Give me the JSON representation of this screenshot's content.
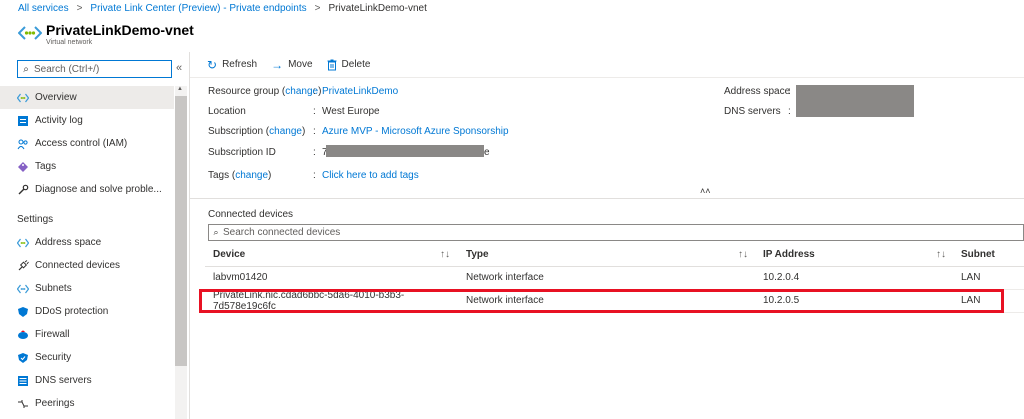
{
  "breadcrumb": {
    "items": [
      "All services",
      "Private Link Center (Preview) - Private endpoints"
    ],
    "current": "PrivateLinkDemo-vnet",
    "separator": ">"
  },
  "resource": {
    "title": "PrivateLinkDemo-vnet",
    "subtitle": "Virtual network",
    "icon": "vnet-icon"
  },
  "sidebar": {
    "search_placeholder": "Search (Ctrl+/)",
    "collapse_glyph": "«",
    "items": [
      {
        "label": "Overview",
        "icon": "vnet-icon",
        "active": true
      },
      {
        "label": "Activity log",
        "icon": "activity-log-icon"
      },
      {
        "label": "Access control (IAM)",
        "icon": "people-icon"
      },
      {
        "label": "Tags",
        "icon": "tag-icon"
      },
      {
        "label": "Diagnose and solve proble...",
        "icon": "wrench-icon"
      }
    ],
    "section_title": "Settings",
    "settings_items": [
      {
        "label": "Address space",
        "icon": "vnet-icon"
      },
      {
        "label": "Connected devices",
        "icon": "plug-icon"
      },
      {
        "label": "Subnets",
        "icon": "vnet-icon"
      },
      {
        "label": "DDoS protection",
        "icon": "shield-icon"
      },
      {
        "label": "Firewall",
        "icon": "firewall-icon"
      },
      {
        "label": "Security",
        "icon": "security-shield-icon"
      },
      {
        "label": "DNS servers",
        "icon": "dns-icon"
      },
      {
        "label": "Peerings",
        "icon": "peering-icon"
      }
    ]
  },
  "toolbar": {
    "refresh_label": "Refresh",
    "move_label": "Move",
    "delete_label": "Delete"
  },
  "essentials": {
    "resource_group_label": "Resource group",
    "change_label": "change",
    "resource_group_value": "PrivateLinkDemo",
    "location_label": "Location",
    "location_value": "West Europe",
    "subscription_label": "Subscription",
    "subscription_value": "Azure MVP - Microsoft Azure Sponsorship",
    "subscription_id_label": "Subscription ID",
    "subscription_id_prefix": "7",
    "subscription_id_suffix": "e",
    "tags_label": "Tags",
    "tags_value": "Click here to add tags",
    "address_space_label": "Address space",
    "dns_servers_label": "DNS servers",
    "colon": ":",
    "collapse_glyph": "˄˄"
  },
  "connected_devices": {
    "title": "Connected devices",
    "search_placeholder": "Search connected devices",
    "columns": [
      "Device",
      "Type",
      "IP Address",
      "Subnet"
    ],
    "sort_glyph": "↑↓",
    "rows": [
      {
        "device": "labvm01420",
        "type": "Network interface",
        "ip": "10.2.0.4",
        "subnet": "LAN"
      },
      {
        "device": "PrivateLink.nic.cdad6bbc-5da6-4010-b3b3-7d578e19c6fc",
        "type": "Network interface",
        "ip": "10.2.0.5",
        "subnet": "LAN"
      }
    ]
  },
  "colors": {
    "accent": "#0078d4",
    "highlight": "#e81123",
    "redaction": "#8a8886"
  }
}
